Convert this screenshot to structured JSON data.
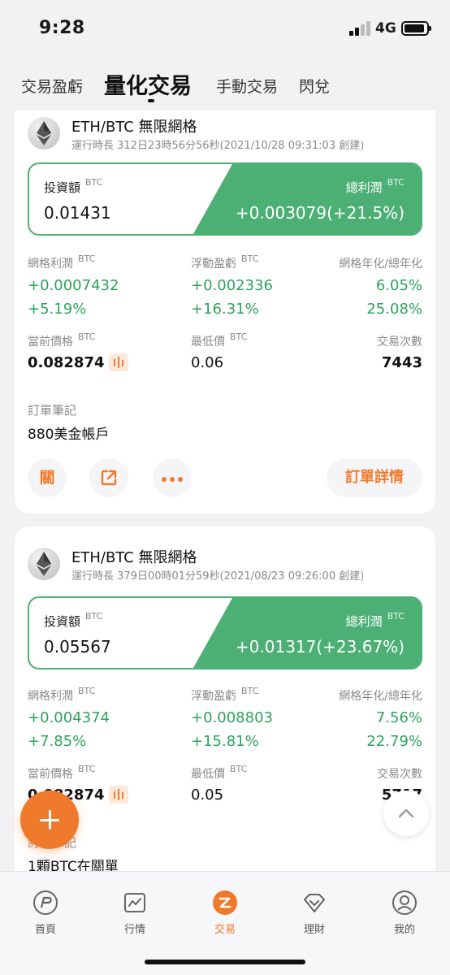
{
  "status": {
    "time": "9:28",
    "network": "4G"
  },
  "tabs": [
    {
      "label": "交易盈虧"
    },
    {
      "label": "量化交易"
    },
    {
      "label": "手動交易"
    },
    {
      "label": "閃兌"
    }
  ],
  "bots": [
    {
      "pair": "ETH/BTC 無限網格",
      "run_info": "運行時長 312日23時56分56秒(2021/10/28 09:31:03 創建)",
      "invest_label": "投資額",
      "invest_unit": "BTC",
      "invest_value": "0.01431",
      "profit_label": "總利潤",
      "profit_unit": "BTC",
      "profit_value": "+0.003079(+21.5%)",
      "grid_profit_label": "網格利潤",
      "grid_profit_unit": "BTC",
      "grid_profit_value": "+0.0007432",
      "grid_profit_pct": "+5.19%",
      "float_pnl_label": "浮動盈虧",
      "float_pnl_unit": "BTC",
      "float_pnl_value": "+0.002336",
      "float_pnl_pct": "+16.31%",
      "annual_label": "網格年化/總年化",
      "grid_annual": "6.05%",
      "total_annual": "25.08%",
      "price_label": "當前價格",
      "price_unit": "BTC",
      "price_value": "0.082874",
      "low_label": "最低價",
      "low_unit": "BTC",
      "low_value": "0.06",
      "trades_label": "交易次數",
      "trades_value": "7443",
      "note_label": "訂單筆記",
      "note_text": "880美金帳戶",
      "close_label": "關",
      "detail_label": "訂單詳情"
    },
    {
      "pair": "ETH/BTC 無限網格",
      "run_info": "運行時長 379日00時01分59秒(2021/08/23 09:26:00 創建)",
      "invest_label": "投資額",
      "invest_unit": "BTC",
      "invest_value": "0.05567",
      "profit_label": "總利潤",
      "profit_unit": "BTC",
      "profit_value": "+0.01317(+23.67%)",
      "grid_profit_label": "網格利潤",
      "grid_profit_unit": "BTC",
      "grid_profit_value": "+0.004374",
      "grid_profit_pct": "+7.85%",
      "float_pnl_label": "浮動盈虧",
      "float_pnl_unit": "BTC",
      "float_pnl_value": "+0.008803",
      "float_pnl_pct": "+15.81%",
      "annual_label": "網格年化/總年化",
      "grid_annual": "7.56%",
      "total_annual": "22.79%",
      "price_label": "當前價格",
      "price_unit": "BTC",
      "price_value": "0.082874",
      "low_label": "最低價",
      "low_unit": "BTC",
      "low_value": "0.05",
      "trades_label": "交易次數",
      "trades_value": "5717",
      "note_label": "訂單筆記",
      "note_text": "1顆BTC在關單"
    }
  ],
  "nav": [
    {
      "label": "首頁",
      "icon": "home-icon"
    },
    {
      "label": "行情",
      "icon": "market-chart-icon"
    },
    {
      "label": "交易",
      "icon": "trade-icon"
    },
    {
      "label": "理財",
      "icon": "finance-diamond-icon"
    },
    {
      "label": "我的",
      "icon": "profile-icon"
    }
  ],
  "colors": {
    "accent": "#f07a2c",
    "profit_green": "#4caf74",
    "text_green": "#2fa25c"
  }
}
